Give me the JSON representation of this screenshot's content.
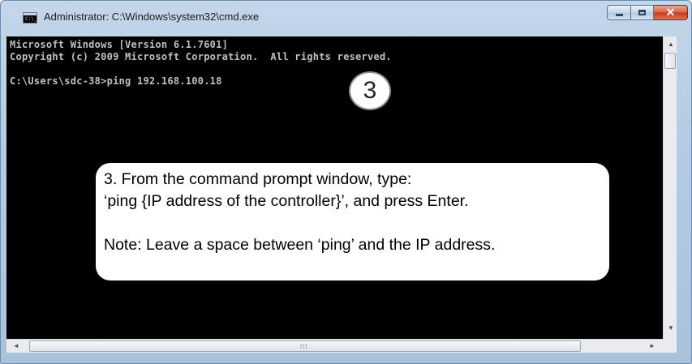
{
  "window": {
    "title": "Administrator: C:\\Windows\\system32\\cmd.exe",
    "icon": "cmd-icon"
  },
  "controls": {
    "minimize": "minimize-icon",
    "maximize": "maximize-icon",
    "close": "close-icon",
    "close_glyph": "✕"
  },
  "console": {
    "lines": [
      "Microsoft Windows [Version 6.1.7601]",
      "Copyright (c) 2009 Microsoft Corporation.  All rights reserved.",
      "",
      "C:\\Users\\sdc-38>ping 192.168.100.18"
    ],
    "background": "#000000",
    "text_color": "#c0c0c0"
  },
  "step_badge": "3",
  "callout": {
    "line1": "3.  From the command prompt window, type:",
    "line2": "‘ping {IP address of the controller}’, and press Enter.",
    "line3": "Note:  Leave a space between ‘ping’ and the IP address."
  },
  "scrollbar": {
    "up": "▲",
    "down": "▼",
    "left": "◄",
    "right": "►",
    "grip": "III"
  }
}
